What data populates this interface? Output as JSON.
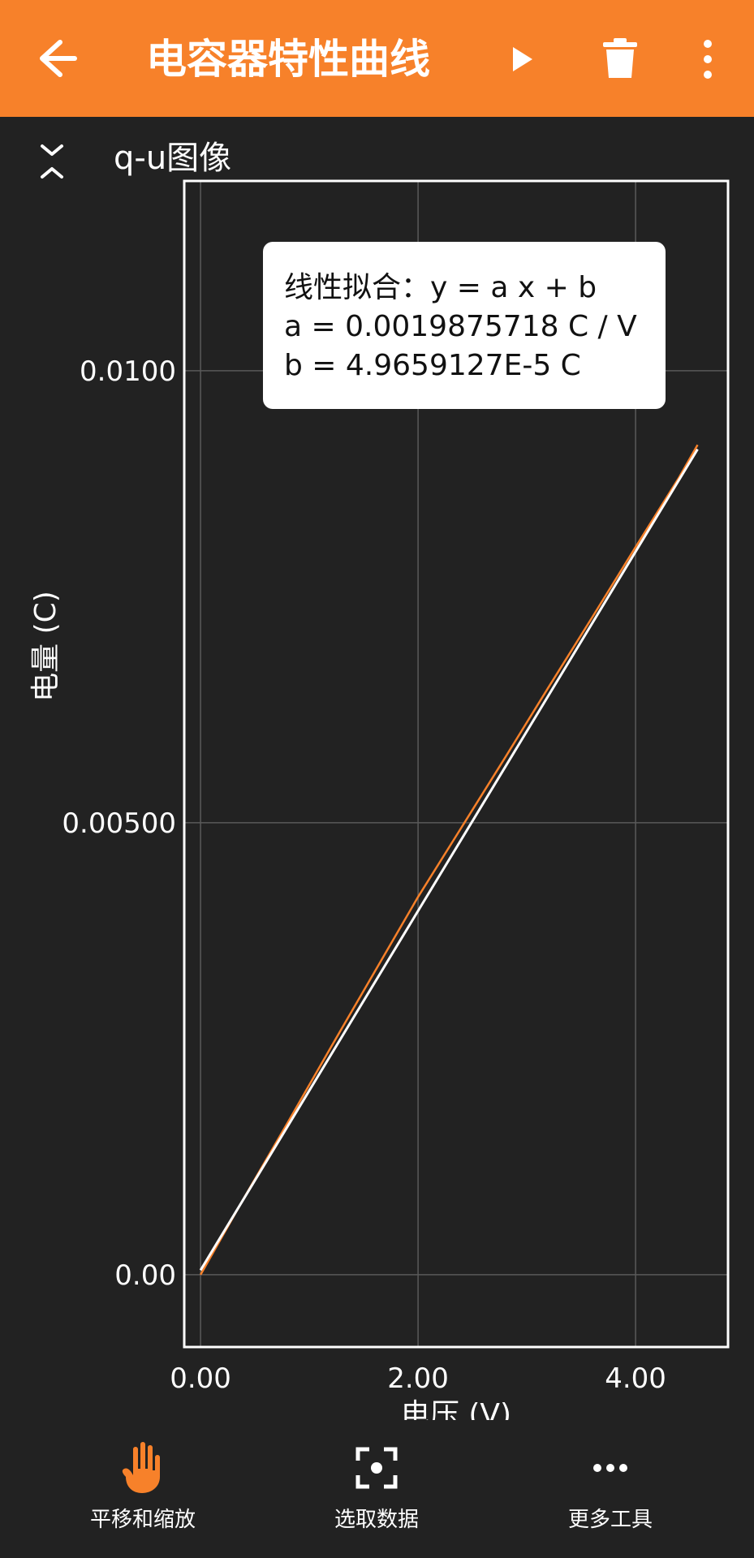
{
  "app": {
    "title": "电容器特性曲线"
  },
  "colors": {
    "accent": "#f7812a",
    "background": "#222222",
    "plot_border": "#ffffff",
    "fit_line": "#ffffff",
    "data_line": "#f7812a"
  },
  "icons": {
    "back": "arrow-left-icon",
    "play": "play-icon",
    "trash": "trash-icon",
    "more": "more-vert-icon",
    "collapse": "collapse-icon",
    "pan": "hand-icon",
    "select": "select-data-icon",
    "tools": "more-horiz-icon"
  },
  "section": {
    "title": "q-u图像"
  },
  "fit": {
    "line1": "线性拟合：y = a x + b",
    "line2": "a = 0.0019875718 C /  V",
    "line3": "b = 4.9659127E-5 C"
  },
  "bottom": {
    "pan_label": "平移和缩放",
    "select_label": "选取数据",
    "tools_label": "更多工具"
  },
  "chart_data": {
    "type": "line",
    "title": "",
    "xlabel": "电压 (V)",
    "ylabel": "电量 (C)",
    "xlim": [
      -0.15,
      4.85
    ],
    "ylim": [
      -0.0008,
      0.0121
    ],
    "x_ticks": [
      0,
      2,
      4
    ],
    "x_tick_labels": [
      "0.00",
      "2.00",
      "4.00"
    ],
    "y_ticks": [
      0,
      0.005,
      0.01
    ],
    "y_tick_labels": [
      "0.00",
      "0.00500",
      "0.0100"
    ],
    "grid": true,
    "series": [
      {
        "x": [
          0.0,
          0.4,
          0.8,
          1.2,
          1.6,
          2.0,
          2.4,
          2.8,
          3.2,
          3.6,
          4.0,
          4.4,
          4.57
        ],
        "values": [
          0.0,
          0.00085,
          0.00168,
          0.00252,
          0.00335,
          0.00418,
          0.00495,
          0.00572,
          0.0065,
          0.00727,
          0.00805,
          0.00882,
          0.00918
        ],
        "color": "#f7812a"
      },
      {
        "x": [
          0.0,
          4.57
        ],
        "values": [
          4.97e-05,
          0.0091326
        ],
        "color": "#ffffff"
      }
    ]
  }
}
